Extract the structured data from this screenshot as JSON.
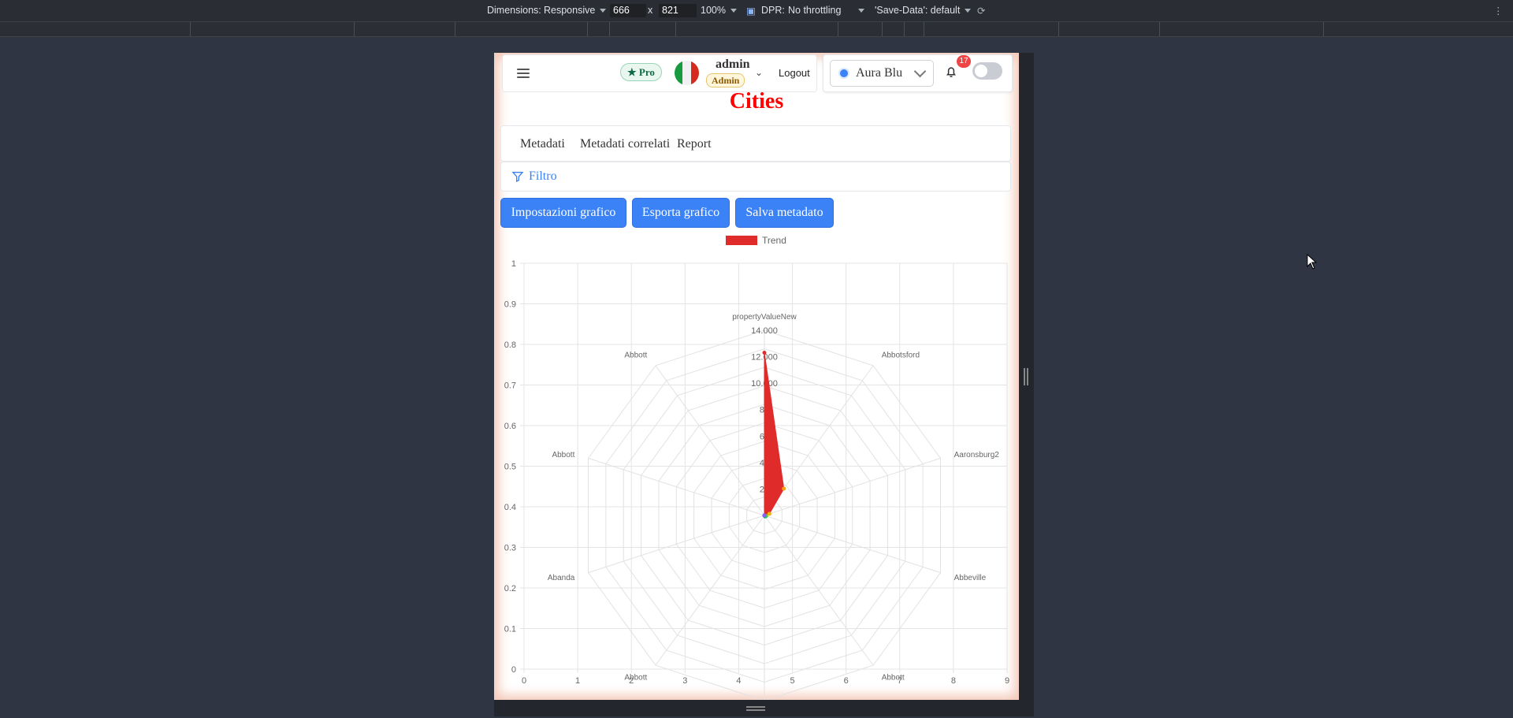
{
  "devtools": {
    "dimensions_label": "Dimensions:",
    "mode": "Responsive",
    "width": "666",
    "times": "x",
    "height": "821",
    "zoom": "100%",
    "dpr_label": "DPR:",
    "throttling": "No throttling",
    "save_data": "'Save-Data': default"
  },
  "header": {
    "pro_label": "Pro",
    "username": "admin",
    "role": "Admin",
    "logout_label": "Logout",
    "theme_label": "Aura Blu",
    "notification_count": "17"
  },
  "page": {
    "title": "Cities",
    "tabs": [
      {
        "label": "Metadati"
      },
      {
        "label": "Metadati correlati"
      },
      {
        "label": "Report"
      }
    ],
    "filter_label": "Filtro",
    "buttons": {
      "settings": "Impostazioni grafico",
      "export": "Esporta grafico",
      "save": "Salva metadato"
    }
  },
  "colors": {
    "accent": "#3b82f6",
    "title": "#ff0000",
    "series": "#e02b2b"
  },
  "chart_data": {
    "type": "radar",
    "legend": [
      "Trend"
    ],
    "legend_position": "top",
    "labels": [
      "propertyValueNew",
      "Abbotsford",
      "Aaronsburg2",
      "Abbeville",
      "Abbott",
      "Abbott",
      "Abbott",
      "Abanda",
      "Abbott",
      "Abbott"
    ],
    "series": [
      {
        "name": "Trend",
        "values": [
          12300,
          2500,
          400,
          150,
          100,
          0,
          0,
          0,
          0,
          0
        ]
      }
    ],
    "r_ticks": [
      "20",
      "40",
      "60",
      "80",
      "10.000",
      "12.000",
      "14.000"
    ],
    "r_max": 14000,
    "x_ticks": [
      "0",
      "1",
      "2",
      "3",
      "4",
      "5",
      "6",
      "7",
      "8",
      "9"
    ],
    "y_ticks": [
      "0",
      "0.1",
      "0.2",
      "0.3",
      "0.4",
      "0.5",
      "0.6",
      "0.7",
      "0.8",
      "0.9",
      "1"
    ],
    "xlim": [
      0,
      9
    ],
    "ylim": [
      0,
      1
    ],
    "grid": true
  }
}
